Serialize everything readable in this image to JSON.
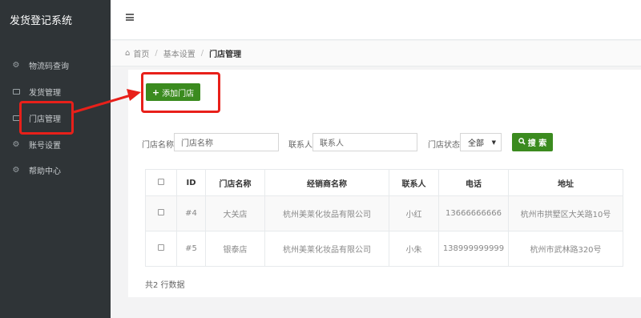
{
  "app": {
    "title": "发货登记系统"
  },
  "sidebar": {
    "items": [
      {
        "label": "物流码查询",
        "icon": "gear-icon"
      },
      {
        "label": "发货管理",
        "icon": "window-icon"
      },
      {
        "label": "门店管理",
        "icon": "window-icon"
      },
      {
        "label": "账号设置",
        "icon": "gear-icon"
      },
      {
        "label": "帮助中心",
        "icon": "gear-icon"
      }
    ]
  },
  "breadcrumb": {
    "home": "首页",
    "level2": "基本设置",
    "current": "门店管理"
  },
  "toolbar": {
    "add_label": "添加门店"
  },
  "filters": {
    "store_name_label": "门店名称",
    "store_name_placeholder": "门店名称",
    "contact_label": "联系人",
    "contact_placeholder": "联系人",
    "status_label": "门店状态",
    "status_value": "全部",
    "search_label": "搜 索"
  },
  "table": {
    "headers": [
      "ID",
      "门店名称",
      "经销商名称",
      "联系人",
      "电话",
      "地址"
    ],
    "rows": [
      {
        "id": "#4",
        "store": "大关店",
        "dealer": "杭州美莱化妆品有限公司",
        "contact": "小红",
        "phone": "13666666666",
        "address": "杭州市拱墅区大关路10号"
      },
      {
        "id": "#5",
        "store": "银泰店",
        "dealer": "杭州美莱化妆品有限公司",
        "contact": "小朱",
        "phone": "138999999999",
        "address": "杭州市武林路320号"
      }
    ]
  },
  "footer": {
    "row_count": "共2 行数据"
  },
  "colors": {
    "sidebar_bg": "#2f3437",
    "primary_green": "#3b8b1f",
    "annotation_red": "#e8201a"
  }
}
